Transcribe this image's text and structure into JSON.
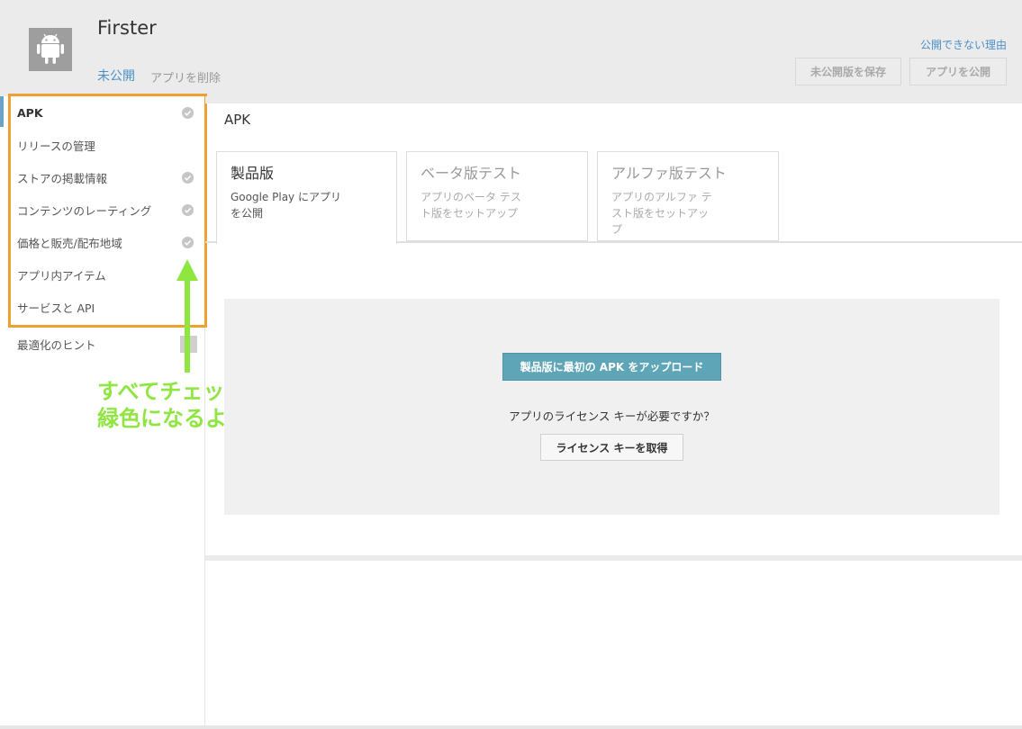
{
  "header": {
    "app_name": "Firster",
    "status": "未公開",
    "delete_link": "アプリを削除",
    "unpublish_reason_link": "公開できない理由",
    "save_draft_button": "未公開版を保存",
    "publish_button": "アプリを公開",
    "app_icon": "android-icon"
  },
  "sidebar": {
    "items": [
      {
        "label": "APK",
        "checked": true,
        "active": true
      },
      {
        "label": "リリースの管理",
        "checked": false
      },
      {
        "label": "ストアの掲載情報",
        "checked": true
      },
      {
        "label": "コンテンツのレーティング",
        "checked": true
      },
      {
        "label": "価格と販売/配布地域",
        "checked": true
      },
      {
        "label": "アプリ内アイテム",
        "checked": false
      },
      {
        "label": "サービスと API",
        "checked": false
      },
      {
        "label": "最適化のヒント",
        "checked": false
      }
    ]
  },
  "annotation": {
    "text": "すべてチェックが\n緑色になるように",
    "color": "#8fe640",
    "frame_color": "#f0a030"
  },
  "main": {
    "heading": "APK",
    "tabs": [
      {
        "title": "製品版",
        "description": "Google Play にアプリ\nを公開",
        "active": true
      },
      {
        "title": "ベータ版テスト",
        "description": "アプリのベータ テス\nト版をセットアップ"
      },
      {
        "title": "アルファ版テスト",
        "description": "アプリのアルファ テ\nスト版をセットアッ\nプ"
      }
    ],
    "upload_button": "製品版に最初の APK をアップロード",
    "license_question": "アプリのライセンス キーが必要ですか？",
    "license_button": "ライセンス キーを取得"
  },
  "colors": {
    "accent": "#4a90c8",
    "upload_button": "#5fa5b8"
  }
}
